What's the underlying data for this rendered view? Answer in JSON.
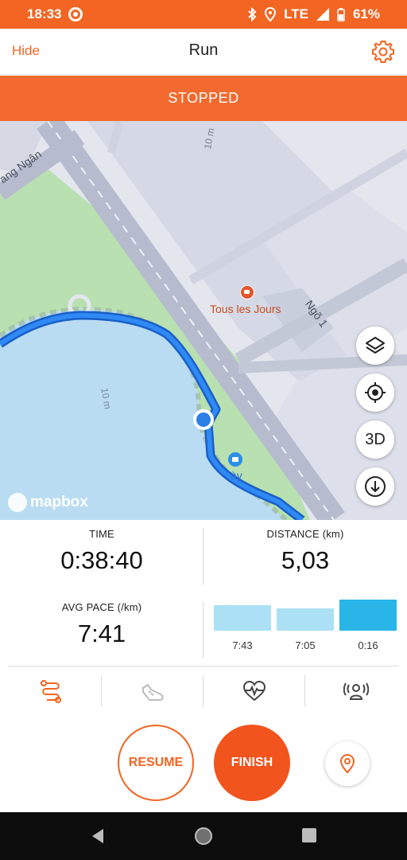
{
  "status_bar": {
    "time": "18:33",
    "network": "LTE",
    "battery": "61%"
  },
  "header": {
    "hide_label": "Hide",
    "title": "Run",
    "settings_icon": "gear-icon"
  },
  "banner": {
    "state": "STOPPED"
  },
  "map": {
    "labels": {
      "street_left": "ang Ngân",
      "alley": "Ngõ 1",
      "poi": "Tous les Jours",
      "poi_partial": "ày",
      "scale_top": "10 m",
      "scale_lake": "10 m",
      "attribution": "mapbox"
    },
    "controls": {
      "layers_icon": "layers-icon",
      "locate_icon": "crosshair-icon",
      "three_d_label": "3D",
      "download_icon": "download-icon"
    },
    "colors": {
      "route": "#1e74e8",
      "water": "#b9dcf3",
      "park": "#b8e0b0",
      "location_dot": "#2c7fe6"
    }
  },
  "stats": {
    "time_label": "TIME",
    "time_value": "0:38:40",
    "distance_label": "DISTANCE  (km)",
    "distance_value": "5,03",
    "pace_label": "AVG PACE  (/km)",
    "pace_value": "7:41"
  },
  "splits": {
    "items": [
      {
        "label": "7:43",
        "level": 0.63
      },
      {
        "label": "7:05",
        "level": 0.55
      },
      {
        "label": "0:16",
        "level": 0.78,
        "current": true
      }
    ],
    "colors": {
      "past": "#abe0f5",
      "current": "#29b5e8"
    }
  },
  "tabs": [
    {
      "icon": "route-icon",
      "active": true
    },
    {
      "icon": "shoe-icon",
      "active": false
    },
    {
      "icon": "heart-rate-icon",
      "active": false
    },
    {
      "icon": "sensor-icon",
      "active": false
    }
  ],
  "actions": {
    "resume_label": "RESUME",
    "finish_label": "FINISH",
    "pin_icon": "location-pin-icon"
  },
  "accent_color": "#f26522"
}
